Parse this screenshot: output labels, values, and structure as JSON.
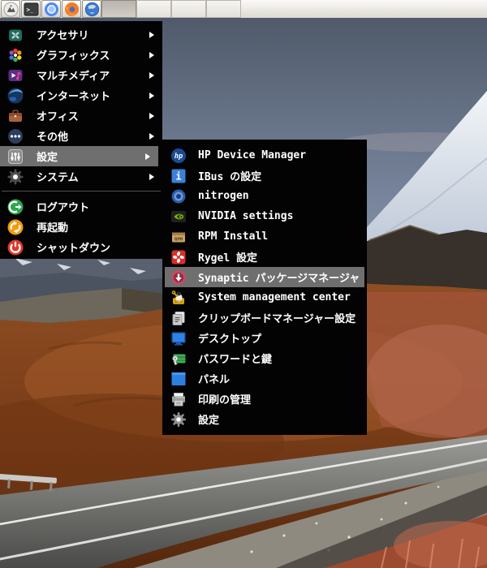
{
  "panel": {
    "terminal_glyph": ">_",
    "launchers": [
      {
        "icon": "distro-logo-icon"
      },
      {
        "icon": "terminal-icon"
      },
      {
        "icon": "chromium-icon"
      },
      {
        "icon": "firefox-icon"
      },
      {
        "icon": "blue-globe-browser-icon"
      }
    ],
    "taskbar_slots": 4
  },
  "main_menu": {
    "items": [
      {
        "label": "アクセサリ",
        "icon": "accessories-icon",
        "has_submenu": true,
        "highlighted": false
      },
      {
        "label": "グラフィックス",
        "icon": "graphics-icon",
        "has_submenu": true,
        "highlighted": false
      },
      {
        "label": "マルチメディア",
        "icon": "multimedia-icon",
        "has_submenu": true,
        "highlighted": false
      },
      {
        "label": "インターネット",
        "icon": "internet-icon",
        "has_submenu": true,
        "highlighted": false
      },
      {
        "label": "オフィス",
        "icon": "office-icon",
        "has_submenu": true,
        "highlighted": false
      },
      {
        "label": "その他",
        "icon": "other-icon",
        "has_submenu": true,
        "highlighted": false
      },
      {
        "label": "設定",
        "icon": "settings-sliders-icon",
        "has_submenu": true,
        "highlighted": true
      },
      {
        "label": "システム",
        "icon": "system-gear-icon",
        "has_submenu": true,
        "highlighted": false
      }
    ],
    "session_items": [
      {
        "label": "ログアウト",
        "icon": "logout-icon"
      },
      {
        "label": "再起動",
        "icon": "restart-icon"
      },
      {
        "label": "シャットダウン",
        "icon": "shutdown-icon"
      }
    ]
  },
  "submenu": {
    "items": [
      {
        "label": "HP Device Manager",
        "icon": "hp-icon",
        "icon_text": "hp",
        "highlighted": false
      },
      {
        "label": "IBus の設定",
        "icon": "ibus-icon",
        "icon_text": "i",
        "highlighted": false
      },
      {
        "label": "nitrogen",
        "icon": "nitrogen-icon",
        "highlighted": false
      },
      {
        "label": "NVIDIA settings",
        "icon": "nvidia-icon",
        "highlighted": false
      },
      {
        "label": "RPM Install",
        "icon": "rpm-package-icon",
        "icon_text": "RPM",
        "highlighted": false
      },
      {
        "label": "Rygel 設定",
        "icon": "rygel-icon",
        "highlighted": false
      },
      {
        "label": "Synaptic パッケージマネージャ",
        "icon": "synaptic-icon",
        "highlighted": true
      },
      {
        "label": "System management center",
        "icon": "management-center-icon",
        "highlighted": false
      },
      {
        "label": "クリップボードマネージャー設定",
        "icon": "clipboard-icon",
        "highlighted": false
      },
      {
        "label": "デスクトップ",
        "icon": "desktop-monitor-icon",
        "highlighted": false
      },
      {
        "label": "パスワードと鍵",
        "icon": "passwords-keys-icon",
        "highlighted": false
      },
      {
        "label": "パネル",
        "icon": "panel-icon",
        "highlighted": false
      },
      {
        "label": "印刷の管理",
        "icon": "printer-icon",
        "highlighted": false
      },
      {
        "label": "設定",
        "icon": "settings-gear-icon",
        "highlighted": false
      }
    ]
  },
  "colors": {
    "menu_background": "#030303",
    "menu_highlight": "#6f6f6f",
    "menu_text": "#ffffff",
    "panel_background": "#e4e1db",
    "sky_top": "#515b6b",
    "sky_bottom": "#93a0b4",
    "field_orange": "#8f4e24",
    "road_gray": "#6f6f6d"
  }
}
